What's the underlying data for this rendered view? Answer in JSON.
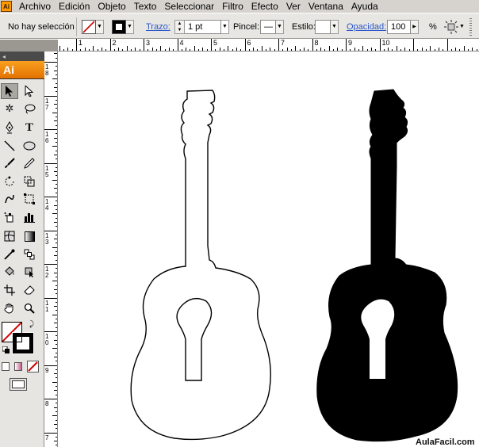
{
  "menubar": {
    "items": [
      "Archivo",
      "Edición",
      "Objeto",
      "Texto",
      "Seleccionar",
      "Filtro",
      "Efecto",
      "Ver",
      "Ventana",
      "Ayuda"
    ]
  },
  "control": {
    "selection_status": "No hay selección",
    "stroke_label": "Trazo:",
    "stroke_weight": "1 pt",
    "brush_label": "Pincel:",
    "brush_value": "—",
    "style_label": "Estilo:",
    "opacity_label": "Opacidad:",
    "opacity_value": "100",
    "opacity_unit": "%"
  },
  "toolbox": {
    "logo": "Ai"
  },
  "ruler_h": {
    "labels": [
      "1",
      "2",
      "3",
      "4",
      "5",
      "6",
      "7",
      "8",
      "9",
      "10"
    ]
  },
  "ruler_v": {
    "labels": [
      "18",
      "17",
      "16",
      "15",
      "14",
      "13",
      "12",
      "11",
      "10",
      "9",
      "8",
      "7"
    ]
  },
  "watermark": "AulaFacil.com",
  "colors": {
    "accent": "#e27100",
    "link": "#2a55c8",
    "guitar_fill": "#000000",
    "guitar_outline": "#000000"
  }
}
